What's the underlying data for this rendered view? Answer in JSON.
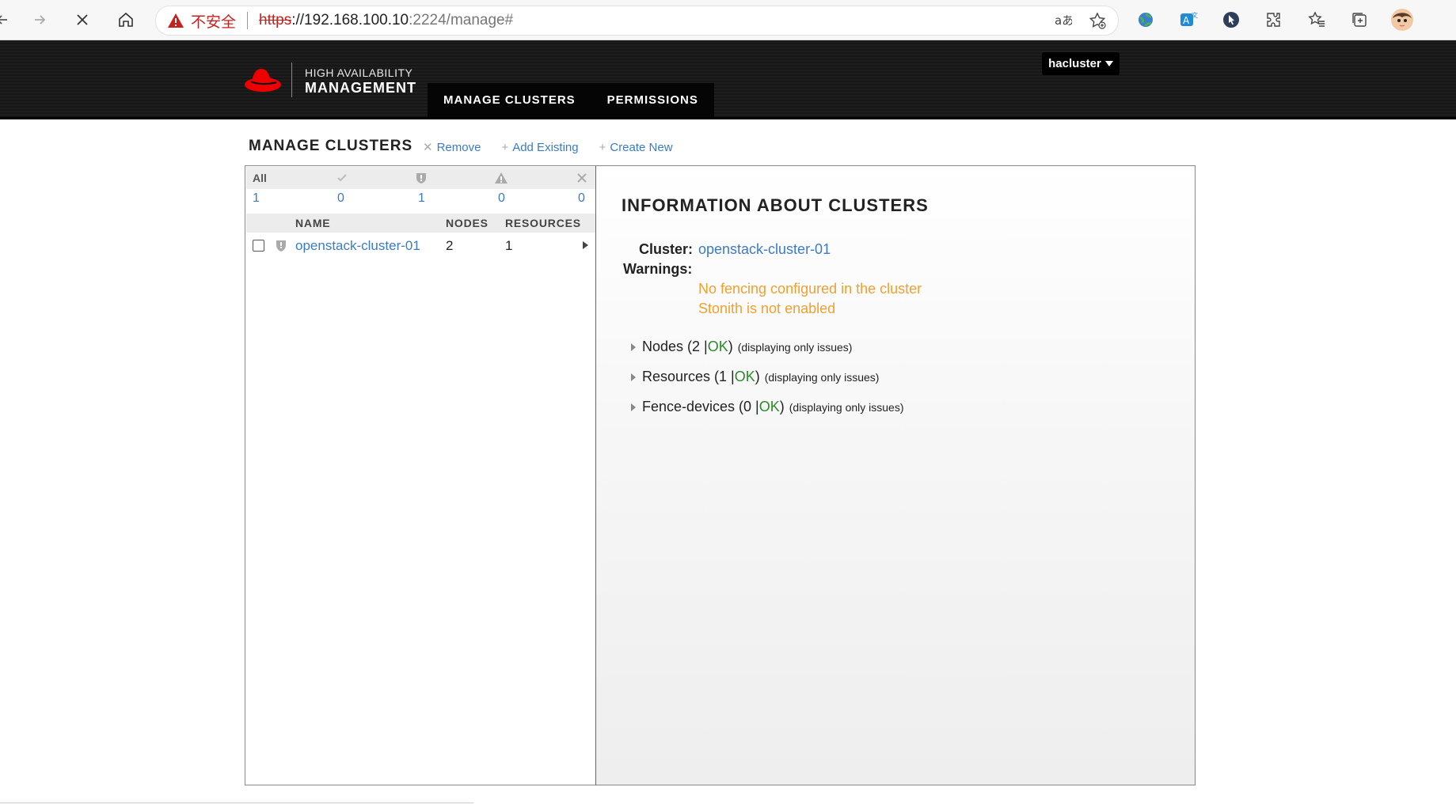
{
  "browser": {
    "insecure_label": "不安全",
    "url_scheme": "https",
    "url_host": "://192.168.100.10",
    "url_rest": ":2224/manage#"
  },
  "header": {
    "logo_line1": "HIGH AVAILABILITY",
    "logo_line2": "MANAGEMENT",
    "tabs": [
      {
        "label": "MANAGE CLUSTERS"
      },
      {
        "label": "PERMISSIONS"
      }
    ],
    "user": "hacluster"
  },
  "page": {
    "title": "MANAGE CLUSTERS",
    "actions": {
      "remove": "Remove",
      "add_existing": "Add Existing",
      "create_new": "Create New"
    }
  },
  "cluster_list": {
    "filter_all": "All",
    "counts": {
      "all": "1",
      "ok": "0",
      "warning": "1",
      "error": "0",
      "unknown": "0"
    },
    "columns": {
      "name": "NAME",
      "nodes": "NODES",
      "resources": "RESOURCES"
    },
    "rows": [
      {
        "name": "openstack-cluster-01",
        "nodes": "2",
        "resources": "1"
      }
    ]
  },
  "info": {
    "title": "INFORMATION ABOUT CLUSTERS",
    "cluster_label": "Cluster:",
    "cluster_name": "openstack-cluster-01",
    "warnings_label": "Warnings:",
    "warnings": [
      "No fencing configured in the cluster",
      "Stonith is not enabled"
    ],
    "sections": [
      {
        "prefix": "Nodes (2 | ",
        "ok": "OK",
        "suffix": ")",
        "note": "(displaying only issues)"
      },
      {
        "prefix": "Resources (1 | ",
        "ok": "OK",
        "suffix": ")",
        "note": "(displaying only issues)"
      },
      {
        "prefix": "Fence-devices (0 | ",
        "ok": "OK",
        "suffix": ")",
        "note": "(displaying only issues)"
      }
    ]
  },
  "colors": {
    "link": "#3b7bc6",
    "warning": "#f0a030",
    "ok": "#2a8a2a",
    "brand_red": "#ee0000"
  }
}
